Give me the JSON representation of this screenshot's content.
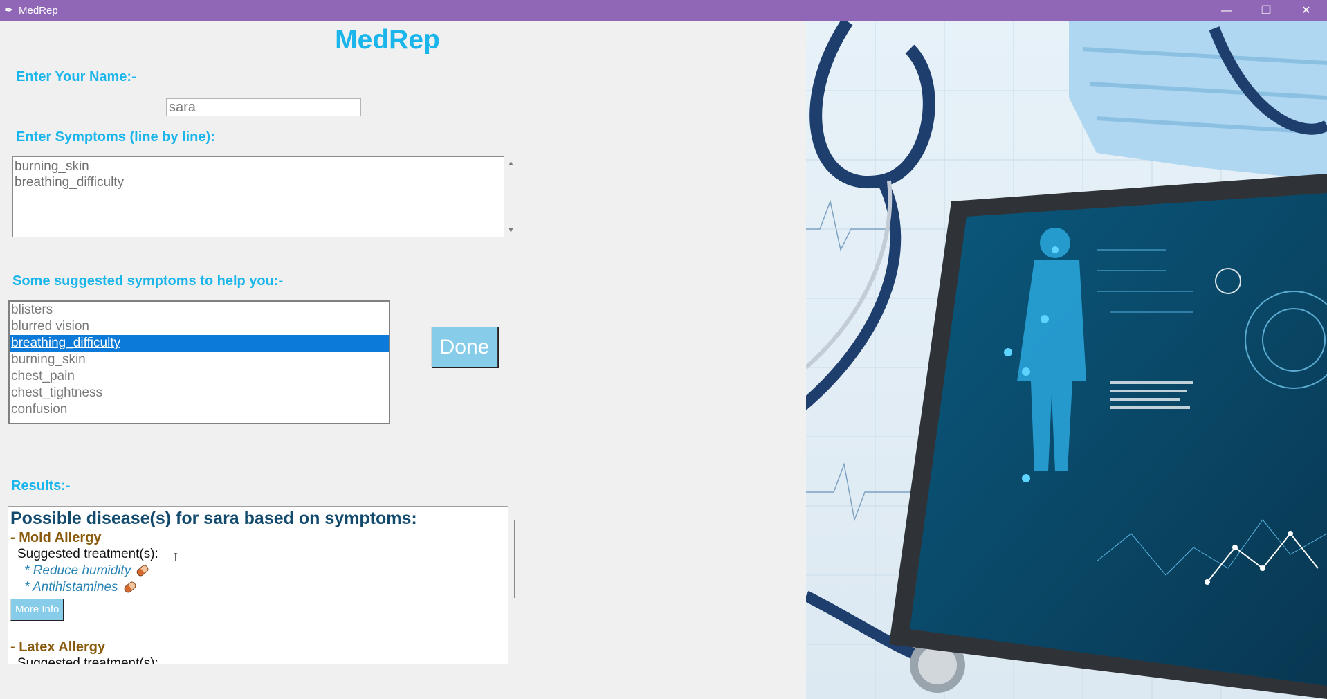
{
  "window": {
    "title": "MedRep"
  },
  "app": {
    "heading": "MedRep"
  },
  "form": {
    "name_label": "Enter Your Name:-",
    "name_value": "sara",
    "symptoms_label": "Enter Symptoms (line by line):",
    "symptoms_lines": [
      "burning_skin",
      "breathing_difficulty"
    ],
    "suggested_label": "Some suggested symptoms to help you:-",
    "suggested_items": [
      "blisters",
      "blurred vision",
      "breathing_difficulty",
      "burning_skin",
      "chest_pain",
      "chest_tightness",
      "confusion"
    ],
    "selected_item": "breathing_difficulty",
    "done_label": "Done"
  },
  "results": {
    "label": "Results:-",
    "title": "Possible disease(s) for sara based on symptoms:",
    "diseases": [
      {
        "name": "- Mold Allergy",
        "suggested": "Suggested treatment(s):",
        "treatments": [
          "* Reduce humidity",
          "* Antihistamines"
        ],
        "more_info": "More Info"
      },
      {
        "name": "- Latex Allergy",
        "suggested": "Suggested treatment(s):"
      }
    ]
  },
  "icons": [
    "feather-icon",
    "minimize-icon",
    "restore-icon",
    "close-icon",
    "pill-icon",
    "text-cursor-icon",
    "scroll-up-icon",
    "scroll-down-icon"
  ],
  "colors": {
    "titlebar": "#8f67b6",
    "accent": "#1ab5ea",
    "button": "#87cdea",
    "selection": "#0c7ad8",
    "disease": "#8a5a0c",
    "treatment": "#2683b3"
  }
}
